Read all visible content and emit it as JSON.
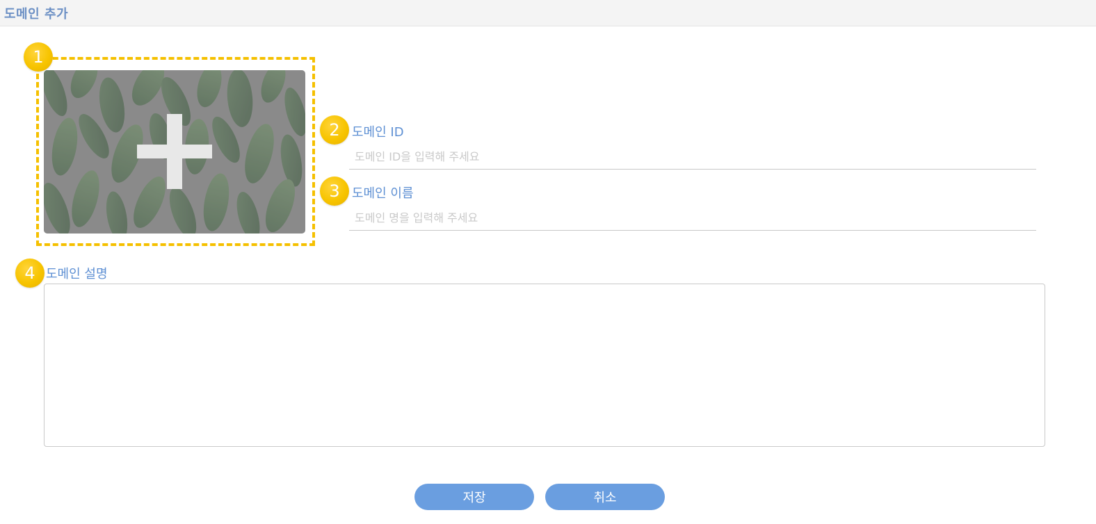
{
  "page": {
    "title": "도메인 추가"
  },
  "badges": [
    "1",
    "2",
    "3",
    "4"
  ],
  "image_upload": {
    "icon": "plus-icon"
  },
  "form": {
    "domain_id": {
      "label": "도메인 ID",
      "placeholder": "도메인 ID을 입력해 주세요",
      "value": ""
    },
    "domain_name": {
      "label": "도메인 이름",
      "placeholder": "도메인 명을 입력해 주세요",
      "value": ""
    },
    "domain_description": {
      "label": "도메인 설명",
      "value": ""
    }
  },
  "buttons": {
    "save": "저장",
    "cancel": "취소"
  },
  "colors": {
    "accent": "#6a9ee0",
    "label": "#5d8fd3",
    "badge": "#f7c400",
    "dashed_border": "#f5c000"
  }
}
